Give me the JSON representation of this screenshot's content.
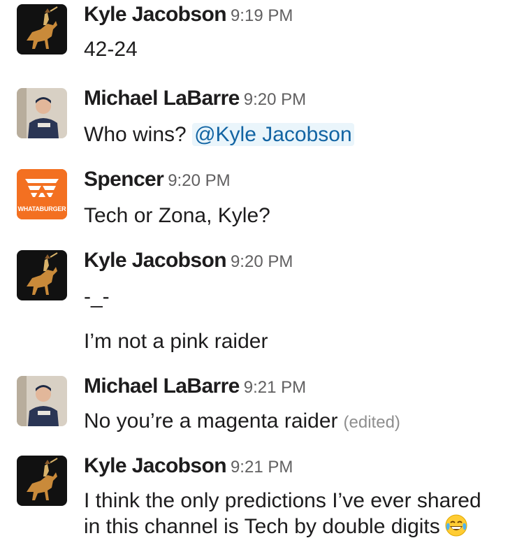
{
  "messages": [
    {
      "sender": "Kyle Jacobson",
      "time": "9:19 PM",
      "avatar": "horse-rider-avatar",
      "lines": [
        "42-24"
      ]
    },
    {
      "sender": "Michael LaBarre",
      "time": "9:20 PM",
      "avatar": "person-photo-avatar",
      "text": "Who wins? ",
      "mention": "@Kyle Jacobson"
    },
    {
      "sender": "Spencer",
      "time": "9:20 PM",
      "avatar": "whataburger-logo-avatar",
      "avatar_label": "WHATABURGER",
      "lines": [
        "Tech or Zona, Kyle?"
      ]
    },
    {
      "sender": "Kyle Jacobson",
      "time": "9:20 PM",
      "avatar": "horse-rider-avatar",
      "lines": [
        "-_-",
        "I’m not a pink raider"
      ]
    },
    {
      "sender": "Michael LaBarre",
      "time": "9:21 PM",
      "avatar": "person-photo-avatar",
      "text": "No you’re a magenta raider",
      "edited": "(edited)"
    },
    {
      "sender": "Kyle Jacobson",
      "time": "9:21 PM",
      "avatar": "horse-rider-avatar",
      "lines": [
        "I think the only predictions I’ve ever shared",
        "in this channel is Tech by double digits"
      ],
      "emoji": "tears-of-joy-emoji"
    }
  ],
  "colors": {
    "mention": "#1264a3",
    "whataburger": "#f37021",
    "timestamp": "#616061"
  }
}
